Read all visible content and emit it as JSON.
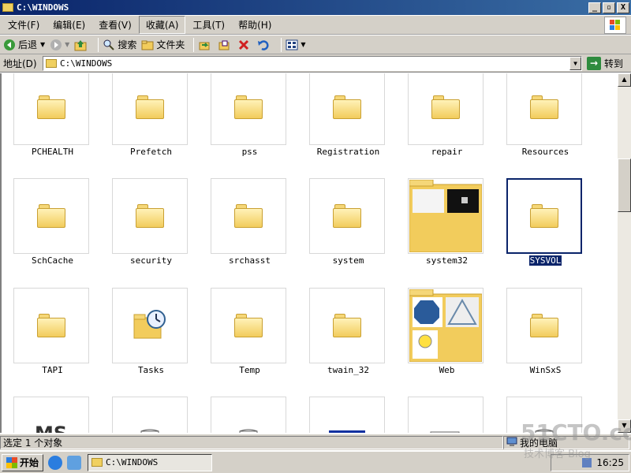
{
  "window": {
    "title": "C:\\WINDOWS",
    "buttons": [
      "_",
      "▫",
      "X"
    ]
  },
  "menu": {
    "items": [
      "文件(F)",
      "编辑(E)",
      "查看(V)",
      "收藏(A)",
      "工具(T)",
      "帮助(H)"
    ],
    "active_index": 3
  },
  "toolbar": {
    "back_label": "后退",
    "search_label": "搜索",
    "folders_label": "文件夹"
  },
  "address": {
    "label": "地址(D)",
    "value": "C:\\WINDOWS",
    "go_label": "转到"
  },
  "folders": [
    {
      "name": "PCHEALTH"
    },
    {
      "name": "Prefetch"
    },
    {
      "name": "pss"
    },
    {
      "name": "Registration"
    },
    {
      "name": "repair"
    },
    {
      "name": "Resources"
    },
    {
      "name": "SchCache"
    },
    {
      "name": "security"
    },
    {
      "name": "srchasst"
    },
    {
      "name": "system"
    },
    {
      "name": "system32"
    },
    {
      "name": "SYSVOL"
    },
    {
      "name": "TAPI"
    },
    {
      "name": "Tasks"
    },
    {
      "name": "Temp"
    },
    {
      "name": "twain_32"
    },
    {
      "name": "Web"
    },
    {
      "name": "WinSxS"
    }
  ],
  "selected_folder": "SYSVOL",
  "partial_row_icons": [
    "ms-logo-icon",
    "text-document-icon",
    "text-document-icon",
    "blue-image-icon",
    "window-document-icon",
    "text-document-icon"
  ],
  "status": {
    "left": "选定 1 个对象",
    "location": "我的电脑"
  },
  "taskbar": {
    "start_label": "开始",
    "task_label": "C:\\WINDOWS",
    "clock": "16:25"
  },
  "watermark": {
    "main": "51CTO.com",
    "sub": "技术博客  Blog"
  },
  "colors": {
    "selection": "#0a246a",
    "folder": "#f2cc5c",
    "chrome": "#d4d0c8"
  }
}
